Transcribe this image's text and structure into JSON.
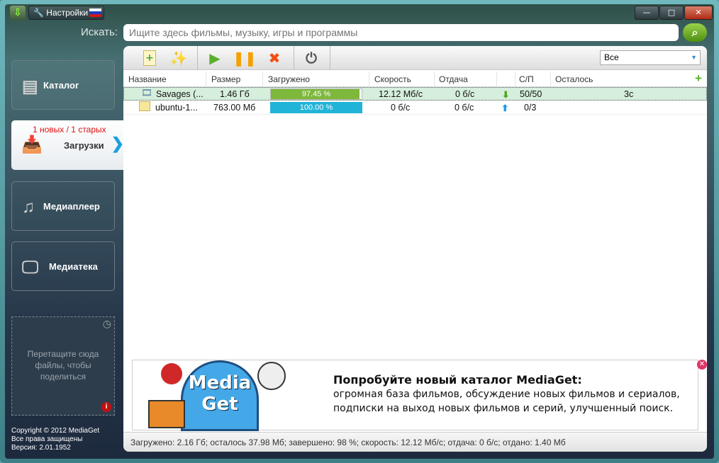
{
  "titlebar": {
    "settings_label": "Настройки",
    "minimize": "—",
    "maximize": "□",
    "close": "✕"
  },
  "search": {
    "label": "Искать:",
    "placeholder": "Ищите здесь фильмы, музыку, игры и программы"
  },
  "sidebar": {
    "items": [
      {
        "label": "Каталог"
      },
      {
        "label": "Загрузки",
        "badge": "1 новых / 1 старых"
      },
      {
        "label": "Медиаплеер"
      },
      {
        "label": "Медиатека"
      }
    ],
    "dropzone": "Перетащите сюда файлы, чтобы поделиться",
    "copyright": [
      "Copyright © 2012 MediaGet",
      "Все права защищены",
      "Версия: 2.01.1952"
    ]
  },
  "filter": {
    "selected": "Все"
  },
  "table": {
    "columns": [
      "Название",
      "Размер",
      "Загружено",
      "Скорость",
      "Отдача",
      "С/П",
      "Осталось"
    ],
    "rows": [
      {
        "name": "Savages (...",
        "size": "1.46 Гб",
        "progress_text": "97.45 %",
        "progress": 97.45,
        "speed": "12.12 Мб/с",
        "upload": "0 б/с",
        "direction": "down",
        "peers": "50/50",
        "remaining": "3с"
      },
      {
        "name": "ubuntu-1...",
        "size": "763.00 Мб",
        "progress_text": "100.00 %",
        "progress": 100,
        "speed": "0 б/с",
        "upload": "0 б/с",
        "direction": "up",
        "peers": "0/3",
        "remaining": ""
      }
    ]
  },
  "ad": {
    "logo": "Media Get",
    "title": "Попробуйте новый каталог MediaGet:",
    "line1": "огромная база фильмов, обсуждение новых фильмов и сериалов,",
    "line2": "подписки на выход новых фильмов и серий, улучшенный поиск."
  },
  "status": "Загружено: 2.16 Гб; осталось 37.98 Мб; завершено: 98 %; скорость: 12.12 Мб/с; отдача: 0 б/с; отдано: 1.40 Мб",
  "colors": {
    "green_bar": "#7db83a",
    "blue_bar": "#22b3d8",
    "selected_row": "#d6eedc"
  }
}
